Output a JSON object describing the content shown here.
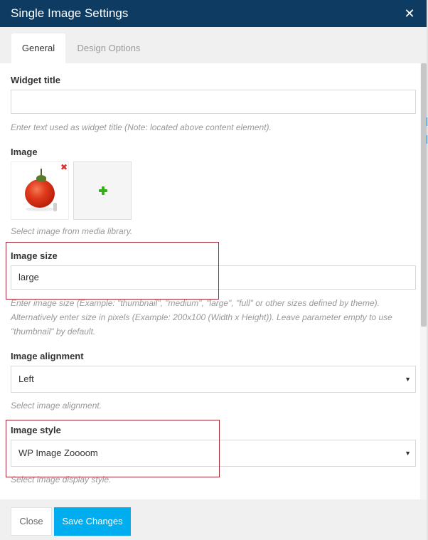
{
  "window": {
    "title": "Single Image Settings",
    "close_icon": "close-icon",
    "colors": {
      "titlebar": "#0e3b61",
      "accent": "#00aef0",
      "highlight": "#a32838"
    }
  },
  "tabs": [
    {
      "label": "General",
      "active": true
    },
    {
      "label": "Design Options",
      "active": false
    }
  ],
  "fields": {
    "widget_title": {
      "label": "Widget title",
      "value": "",
      "help": "Enter text used as widget title (Note: located above content element)."
    },
    "image": {
      "label": "Image",
      "help": "Select image from media library.",
      "remove_icon": "remove-icon",
      "add_icon": "plus-icon"
    },
    "image_size": {
      "label": "Image size",
      "value": "large",
      "help_line1": "Enter image size (Example: \"thumbnail\", \"medium\", \"large\", \"full\" or other sizes defined by theme).",
      "help_line2": "Alternatively enter size in pixels (Example: 200x100 (Width x Height)). Leave parameter empty to use",
      "help_line3": "\"thumbnail\" by default."
    },
    "image_alignment": {
      "label": "Image alignment",
      "value": "Left",
      "help": "Select image alignment."
    },
    "image_style": {
      "label": "Image style",
      "value": "WP Image Zoooom",
      "help": "Select image display style."
    }
  },
  "footer": {
    "close_label": "Close",
    "save_label": "Save Changes"
  }
}
